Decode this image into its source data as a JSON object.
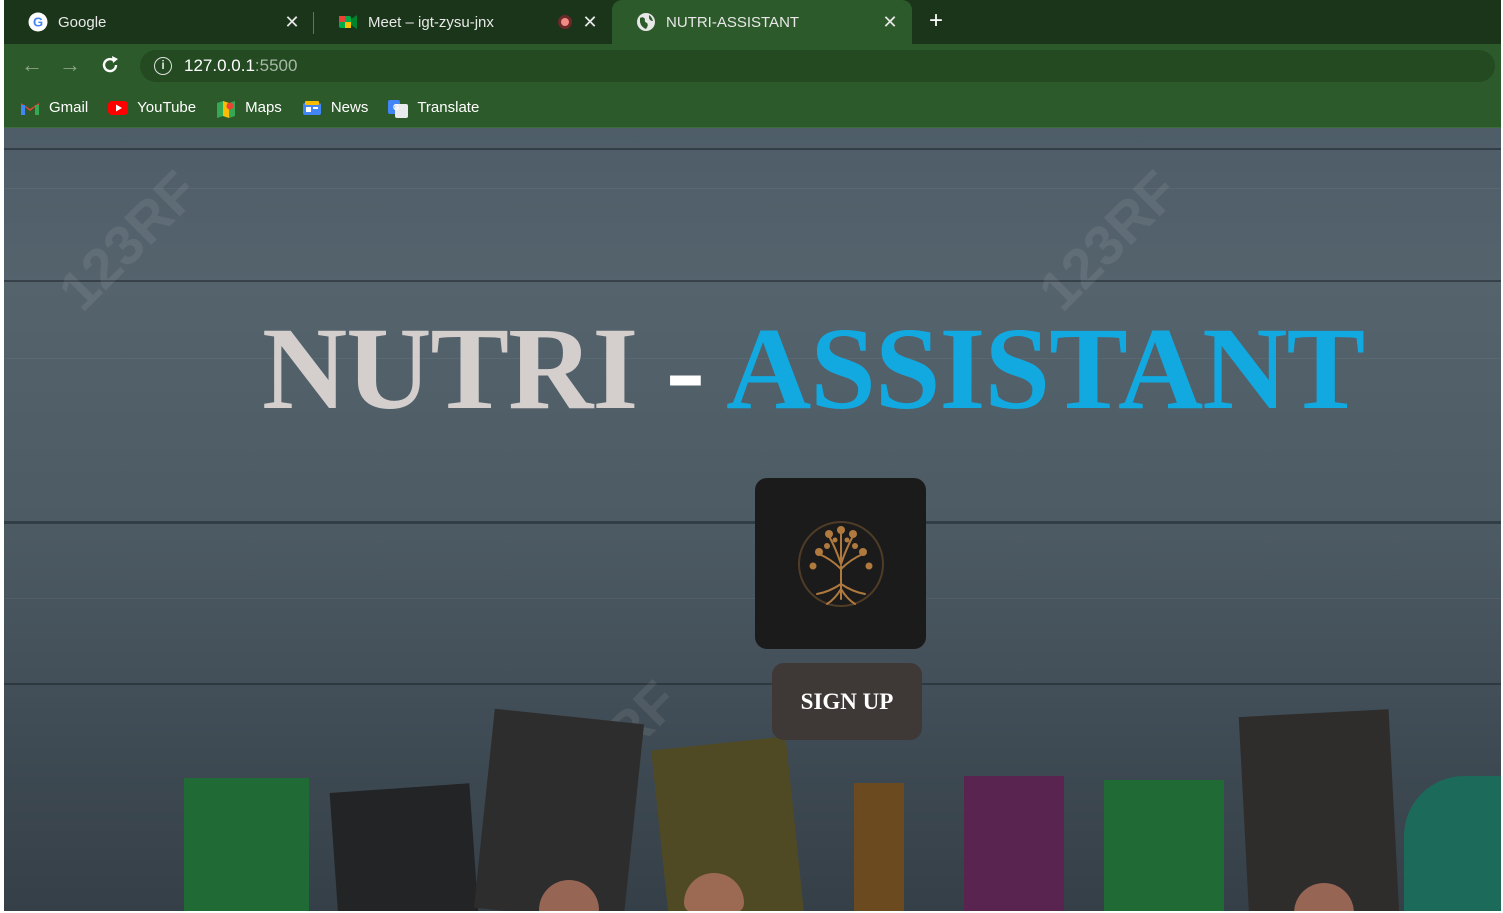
{
  "browser": {
    "tabs": [
      {
        "title": "Google",
        "icon": "google-icon"
      },
      {
        "title": "Meet – igt-zysu-jnx",
        "icon": "meet-icon",
        "recording": true
      },
      {
        "title": "NUTRI-ASSISTANT",
        "icon": "globe-icon",
        "active": true
      }
    ],
    "address": {
      "host": "127.0.0.1",
      "port": ":5500"
    },
    "bookmarks": [
      {
        "label": "Gmail",
        "icon": "gmail-icon"
      },
      {
        "label": "YouTube",
        "icon": "youtube-icon"
      },
      {
        "label": "Maps",
        "icon": "maps-icon"
      },
      {
        "label": "News",
        "icon": "news-icon"
      },
      {
        "label": "Translate",
        "icon": "translate-icon"
      }
    ],
    "colors": {
      "frame": "#1a3519",
      "toolbar": "#2d5a2a"
    }
  },
  "page": {
    "title_part1": "NUTRI",
    "title_dash": "-",
    "title_part2": "ASSISTANT",
    "signup_label": "SIGN UP",
    "logo_icon": "tree-of-life-icon",
    "colors": {
      "title_part1": "#d4cfcd",
      "title_part2": "#12a9e0",
      "button_bg": "#3e3837"
    }
  }
}
